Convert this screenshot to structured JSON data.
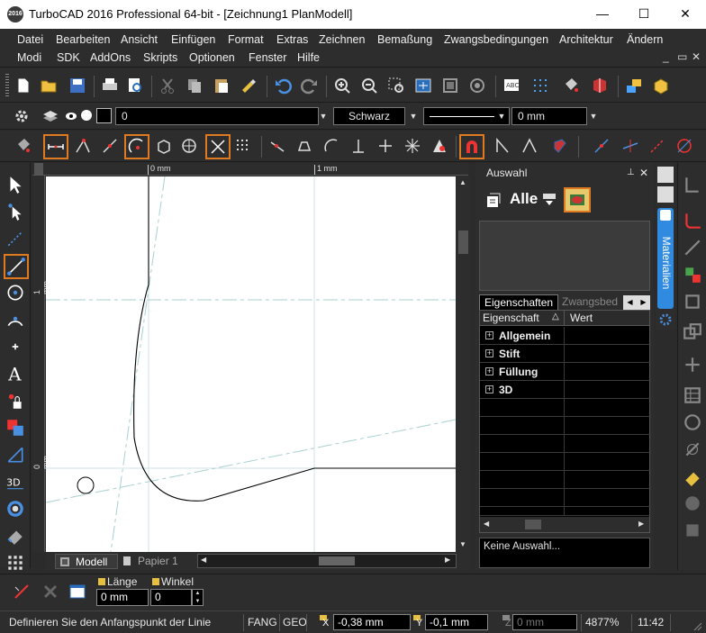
{
  "window": {
    "app_icon_text": "2016",
    "title": "TurboCAD 2016 Professional 64-bit - [Zeichnung1 PlanModell]",
    "controls": {
      "minimize": "—",
      "maximize": "☐",
      "close": "✕"
    }
  },
  "menu": {
    "row1": [
      "Datei",
      "Bearbeiten",
      "Ansicht",
      "Einfügen",
      "Format",
      "Extras",
      "Zeichnen",
      "Bemaßung",
      "Zwangsbedingungen",
      "Architektur",
      "Ändern"
    ],
    "row2": [
      "Modi",
      "SDK",
      "AddOns",
      "Skripts",
      "Optionen",
      "Fenster",
      "Hilfe"
    ],
    "mdi_controls": {
      "minimize": "_",
      "restore": "▭",
      "close": "✕"
    }
  },
  "property_toolbar": {
    "layer_value": "0",
    "color_value": "Schwarz",
    "width_value": "0 mm"
  },
  "rulers": {
    "top_label_1": "0 mm",
    "top_label_2": "1 mm",
    "left_label_1": "1 mm",
    "left_label_2": "0 mm"
  },
  "tabs": {
    "model": "Modell",
    "paper": "Papier 1"
  },
  "selection_panel": {
    "title": "Auswahl",
    "pin": "📌",
    "close": "✕",
    "alle_label": "Alle",
    "tabs": [
      "Eigenschaften",
      "Zwangsbed"
    ],
    "columns": {
      "property": "Eigenschaft",
      "value": "Wert"
    },
    "groups": [
      "Allgemein",
      "Stift",
      "Füllung",
      "3D"
    ],
    "status": "Keine Auswahl..."
  },
  "side_tab": "Materialien",
  "input_bar": {
    "length_label": "Länge",
    "length_value": "0 mm",
    "angle_label": "Winkel",
    "angle_value": "0"
  },
  "status_bar": {
    "prompt": "Definieren Sie den Anfangspunkt der Linie",
    "fang": "FANG",
    "geo": "GEO",
    "x_label": "X",
    "x_value": "-0,38 mm",
    "y_label": "Y",
    "y_value": "-0,1 mm",
    "z_label": "Z",
    "z_value": "0 mm",
    "zoom": "4877%",
    "time": "11:42"
  },
  "colors": {
    "accent_highlight": "#e07a20",
    "ui_background": "#2d2d2d",
    "side_tab_blue": "#2f8ae0"
  }
}
